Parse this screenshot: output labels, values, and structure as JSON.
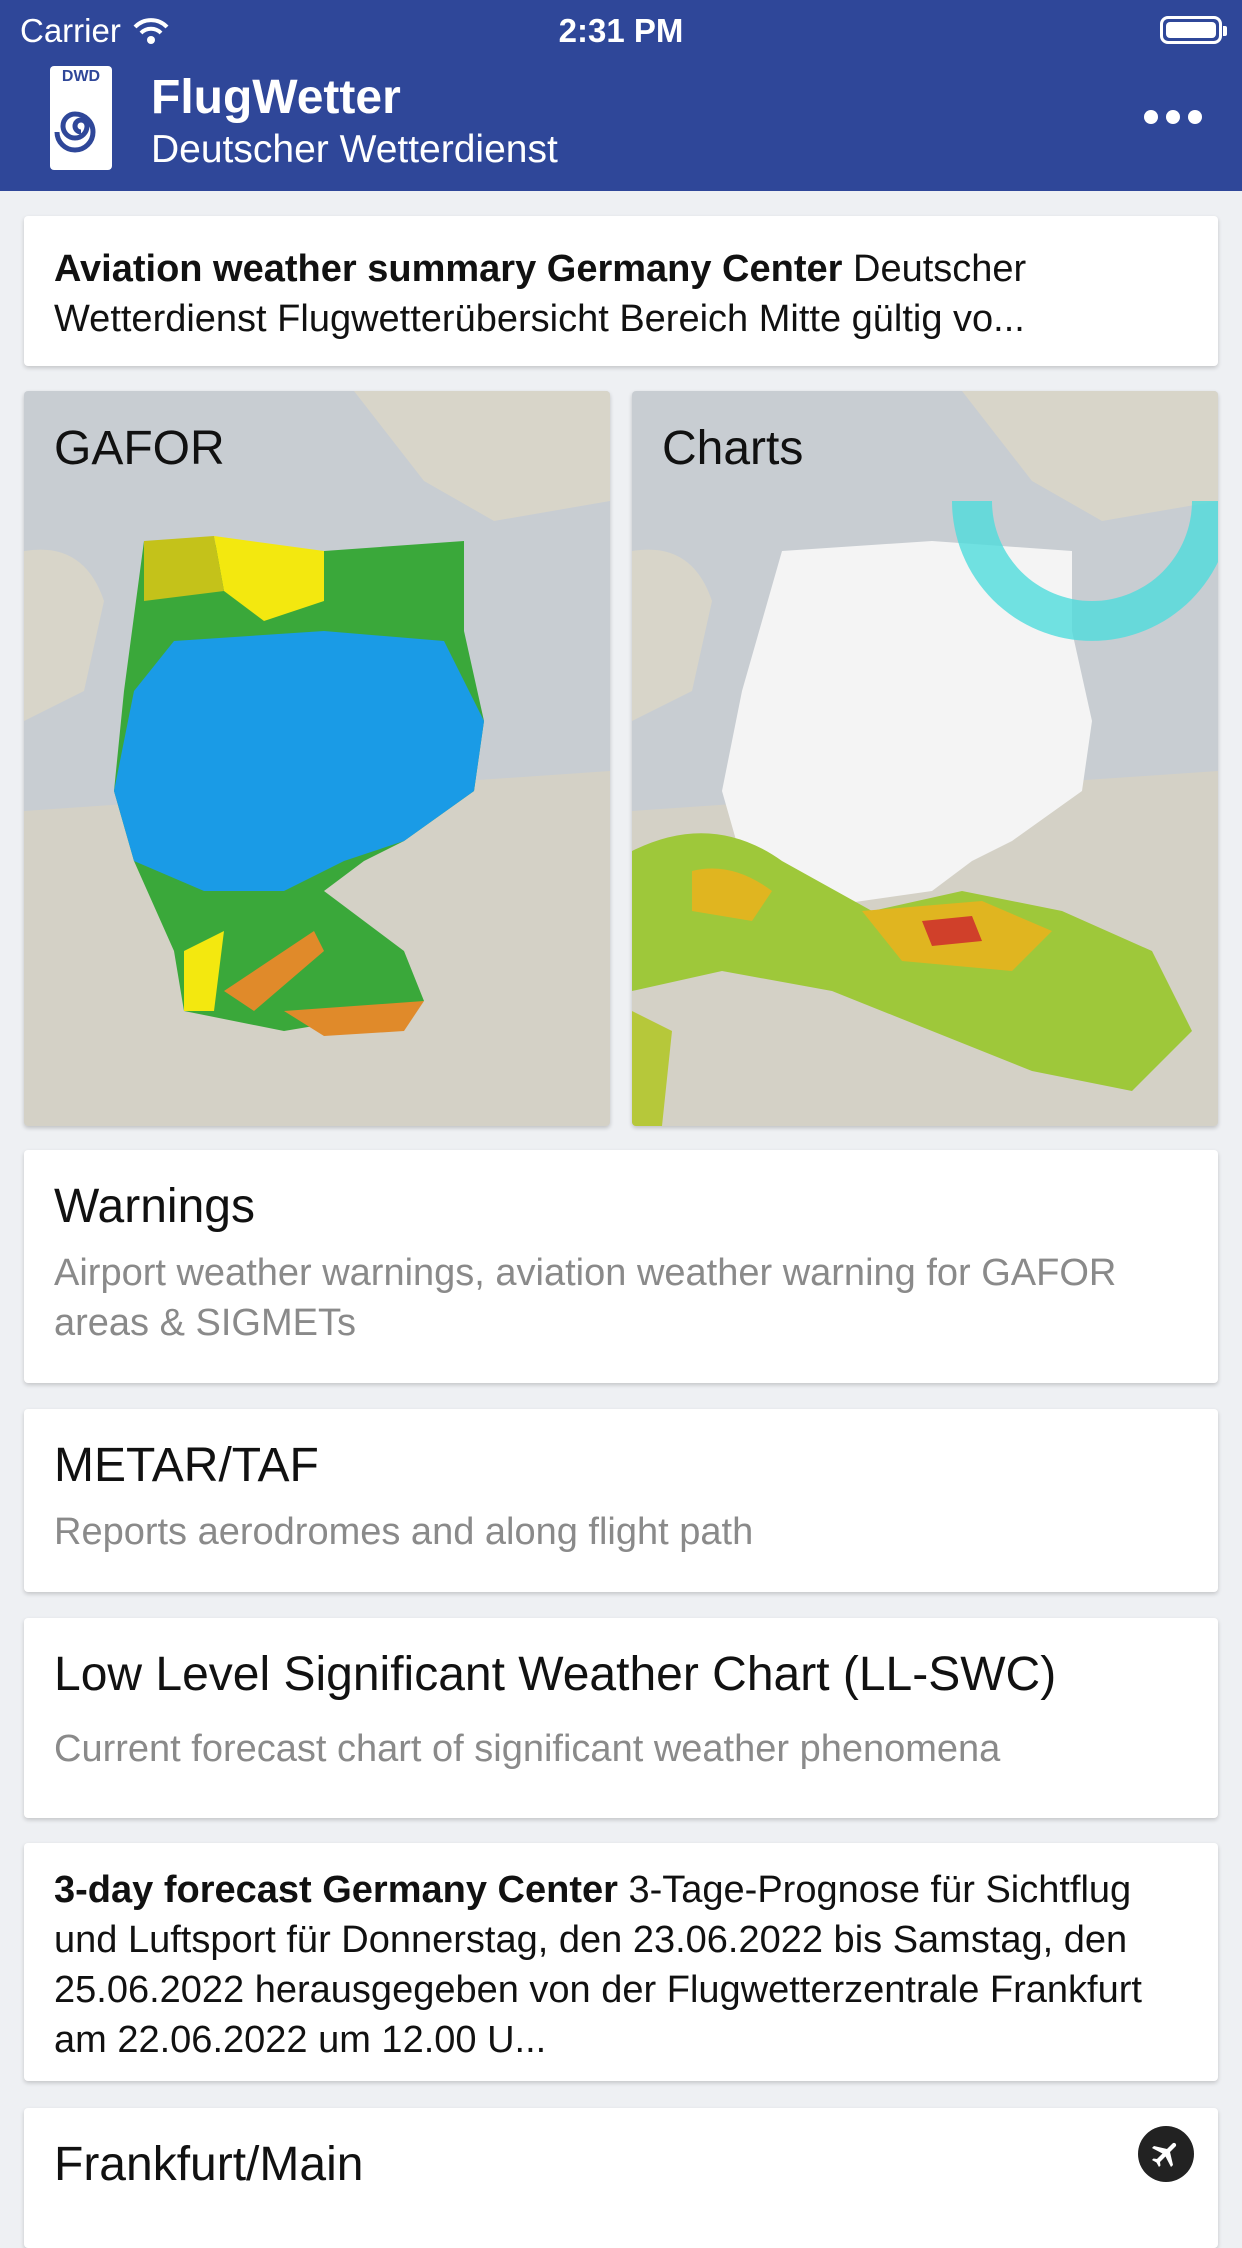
{
  "status": {
    "carrier": "Carrier",
    "time": "2:31 PM"
  },
  "app": {
    "name": "FlugWetter",
    "org": "Deutscher Wetterdienst",
    "logo_text": "DWD"
  },
  "summary": {
    "title": "Aviation weather summary Germany Center",
    "text": "Deutscher Wetterdienst Flugwetterübersicht Bereich Mitte gültig vo..."
  },
  "tiles": [
    {
      "label": "GAFOR"
    },
    {
      "label": "Charts"
    }
  ],
  "warnings": {
    "title": "Warnings",
    "text": "Airport weather warnings, aviation weather warning for GAFOR areas & SIGMETs"
  },
  "metar": {
    "title": "METAR/TAF",
    "text": "Reports aerodromes and along flight path"
  },
  "llswc": {
    "title": "Low Level Significant Weather Chart (LL-SWC)",
    "text": "Current forecast chart of significant weather phenomena"
  },
  "forecast": {
    "title": "3-day forecast Germany Center",
    "text": "3-Tage-Prognose für Sichtflug und Luftsport für Donnerstag, den 23.06.2022 bis Samstag, den 25.06.2022 herausgegeben von der Flugwetterzentrale Frankfurt am 22.06.2022 um 12.00 U..."
  },
  "frankfurt": {
    "title": "Frankfurt/Main"
  },
  "colors": {
    "accent": "#2f4799",
    "gafor_blue": "#1a9be6",
    "gafor_green": "#3aa83a",
    "gafor_yellow": "#f3e80f"
  }
}
